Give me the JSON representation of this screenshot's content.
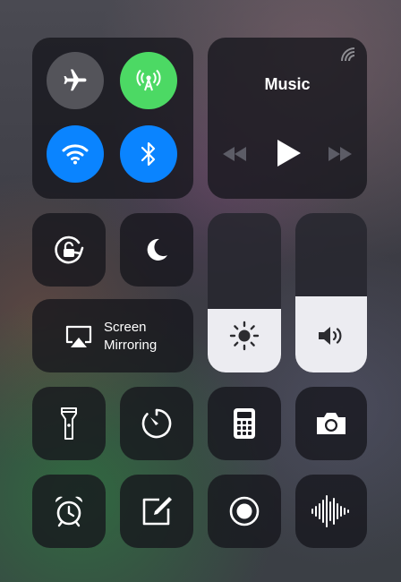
{
  "connectivity": {
    "airplane_icon": "airplane-icon",
    "cellular_icon": "cellular-data-icon",
    "wifi_icon": "wifi-icon",
    "bluetooth_icon": "bluetooth-icon",
    "colors": {
      "active_green": "#4cd964",
      "active_blue": "#0a84ff"
    }
  },
  "music": {
    "title": "Music",
    "airplay_icon": "airplay-audio-icon",
    "controls": [
      "rewind-icon",
      "play-icon",
      "fast-forward-icon"
    ]
  },
  "row2": {
    "rotation_lock_icon": "rotation-lock-icon",
    "do_not_disturb_icon": "moon-icon"
  },
  "screen_mirroring": {
    "line1": "Screen",
    "line2": "Mirroring"
  },
  "sliders": {
    "brightness": {
      "level": 0.4,
      "icon": "sun-icon"
    },
    "volume": {
      "level": 0.48,
      "icon": "speaker-icon"
    }
  },
  "row4": [
    "flashlight-icon",
    "timer-icon",
    "calculator-icon",
    "camera-icon"
  ],
  "row5": [
    "alarm-icon",
    "notes-icon",
    "screen-record-icon",
    "voice-memo-icon"
  ]
}
